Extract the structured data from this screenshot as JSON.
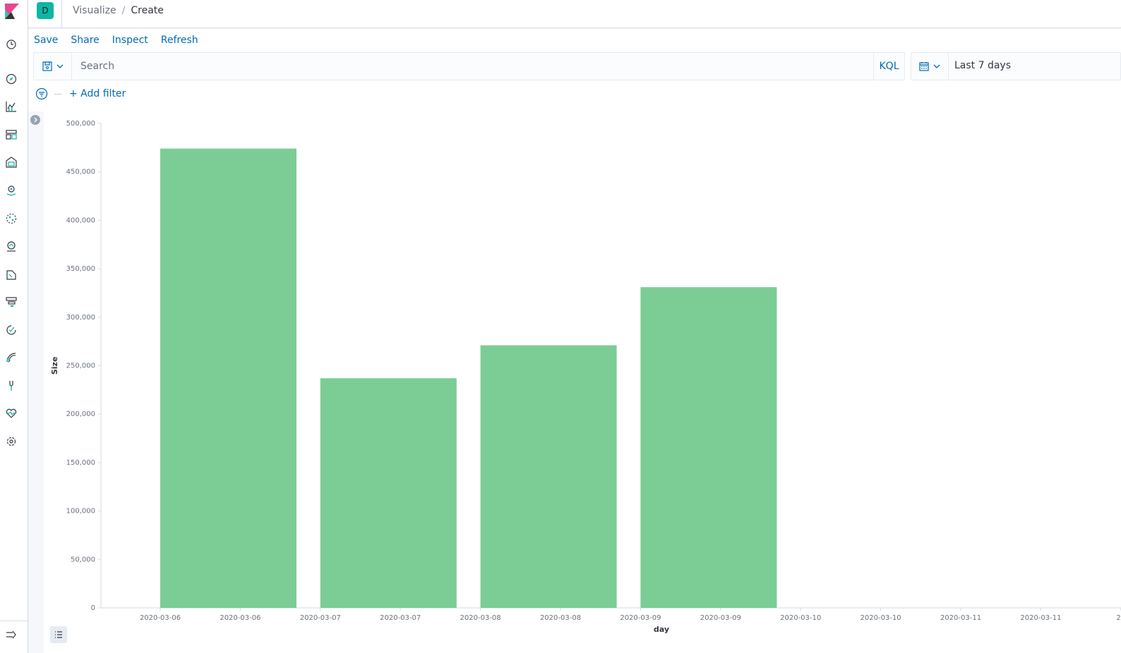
{
  "app": {
    "space_initial": "D",
    "breadcrumbs": [
      "Visualize",
      "Create"
    ],
    "breadcrumb_divider": "/"
  },
  "nav": {
    "icons": [
      "recently-viewed-icon",
      "discover-icon",
      "visualize-icon",
      "dashboard-icon",
      "canvas-icon",
      "maps-icon",
      "ml-icon",
      "infrastructure-icon",
      "logs-icon",
      "apm-icon",
      "uptime-icon",
      "siem-icon",
      "dev-tools-icon",
      "monitoring-icon",
      "management-icon"
    ],
    "collapse_icon": "dock-navigation-icon"
  },
  "topmenu": {
    "save": "Save",
    "share": "Share",
    "inspect": "Inspect",
    "refresh": "Refresh"
  },
  "query": {
    "placeholder": "Search",
    "language": "KQL"
  },
  "time": {
    "range": "Last 7 days"
  },
  "filters": {
    "add_label": "+ Add filter",
    "placeholder_dash": "—"
  },
  "colors": {
    "bar": "#7bcd95",
    "link": "#006bb4",
    "accent": "#10b5a5"
  },
  "chart_data": {
    "type": "bar",
    "xlabel": "day",
    "ylabel": "Size",
    "ylim": [
      0,
      500000
    ],
    "yticks": [
      0,
      50000,
      100000,
      150000,
      200000,
      250000,
      300000,
      350000,
      400000,
      450000,
      500000
    ],
    "ytick_labels": [
      "0",
      "50,000",
      "100,000",
      "150,000",
      "200,000",
      "250,000",
      "300,000",
      "350,000",
      "400,000",
      "450,000",
      "500,000"
    ],
    "x_tick_labels": [
      "2020-03-06",
      "2020-03-06",
      "2020-03-07",
      "2020-03-07",
      "2020-03-08",
      "2020-03-08",
      "2020-03-09",
      "2020-03-09",
      "2020-03-10",
      "2020-03-10",
      "2020-03-11",
      "2020-03-11",
      "20"
    ],
    "categories": [
      "2020-03-06",
      "2020-03-07",
      "2020-03-08",
      "2020-03-09"
    ],
    "values": [
      474000,
      237000,
      271000,
      331000
    ]
  }
}
